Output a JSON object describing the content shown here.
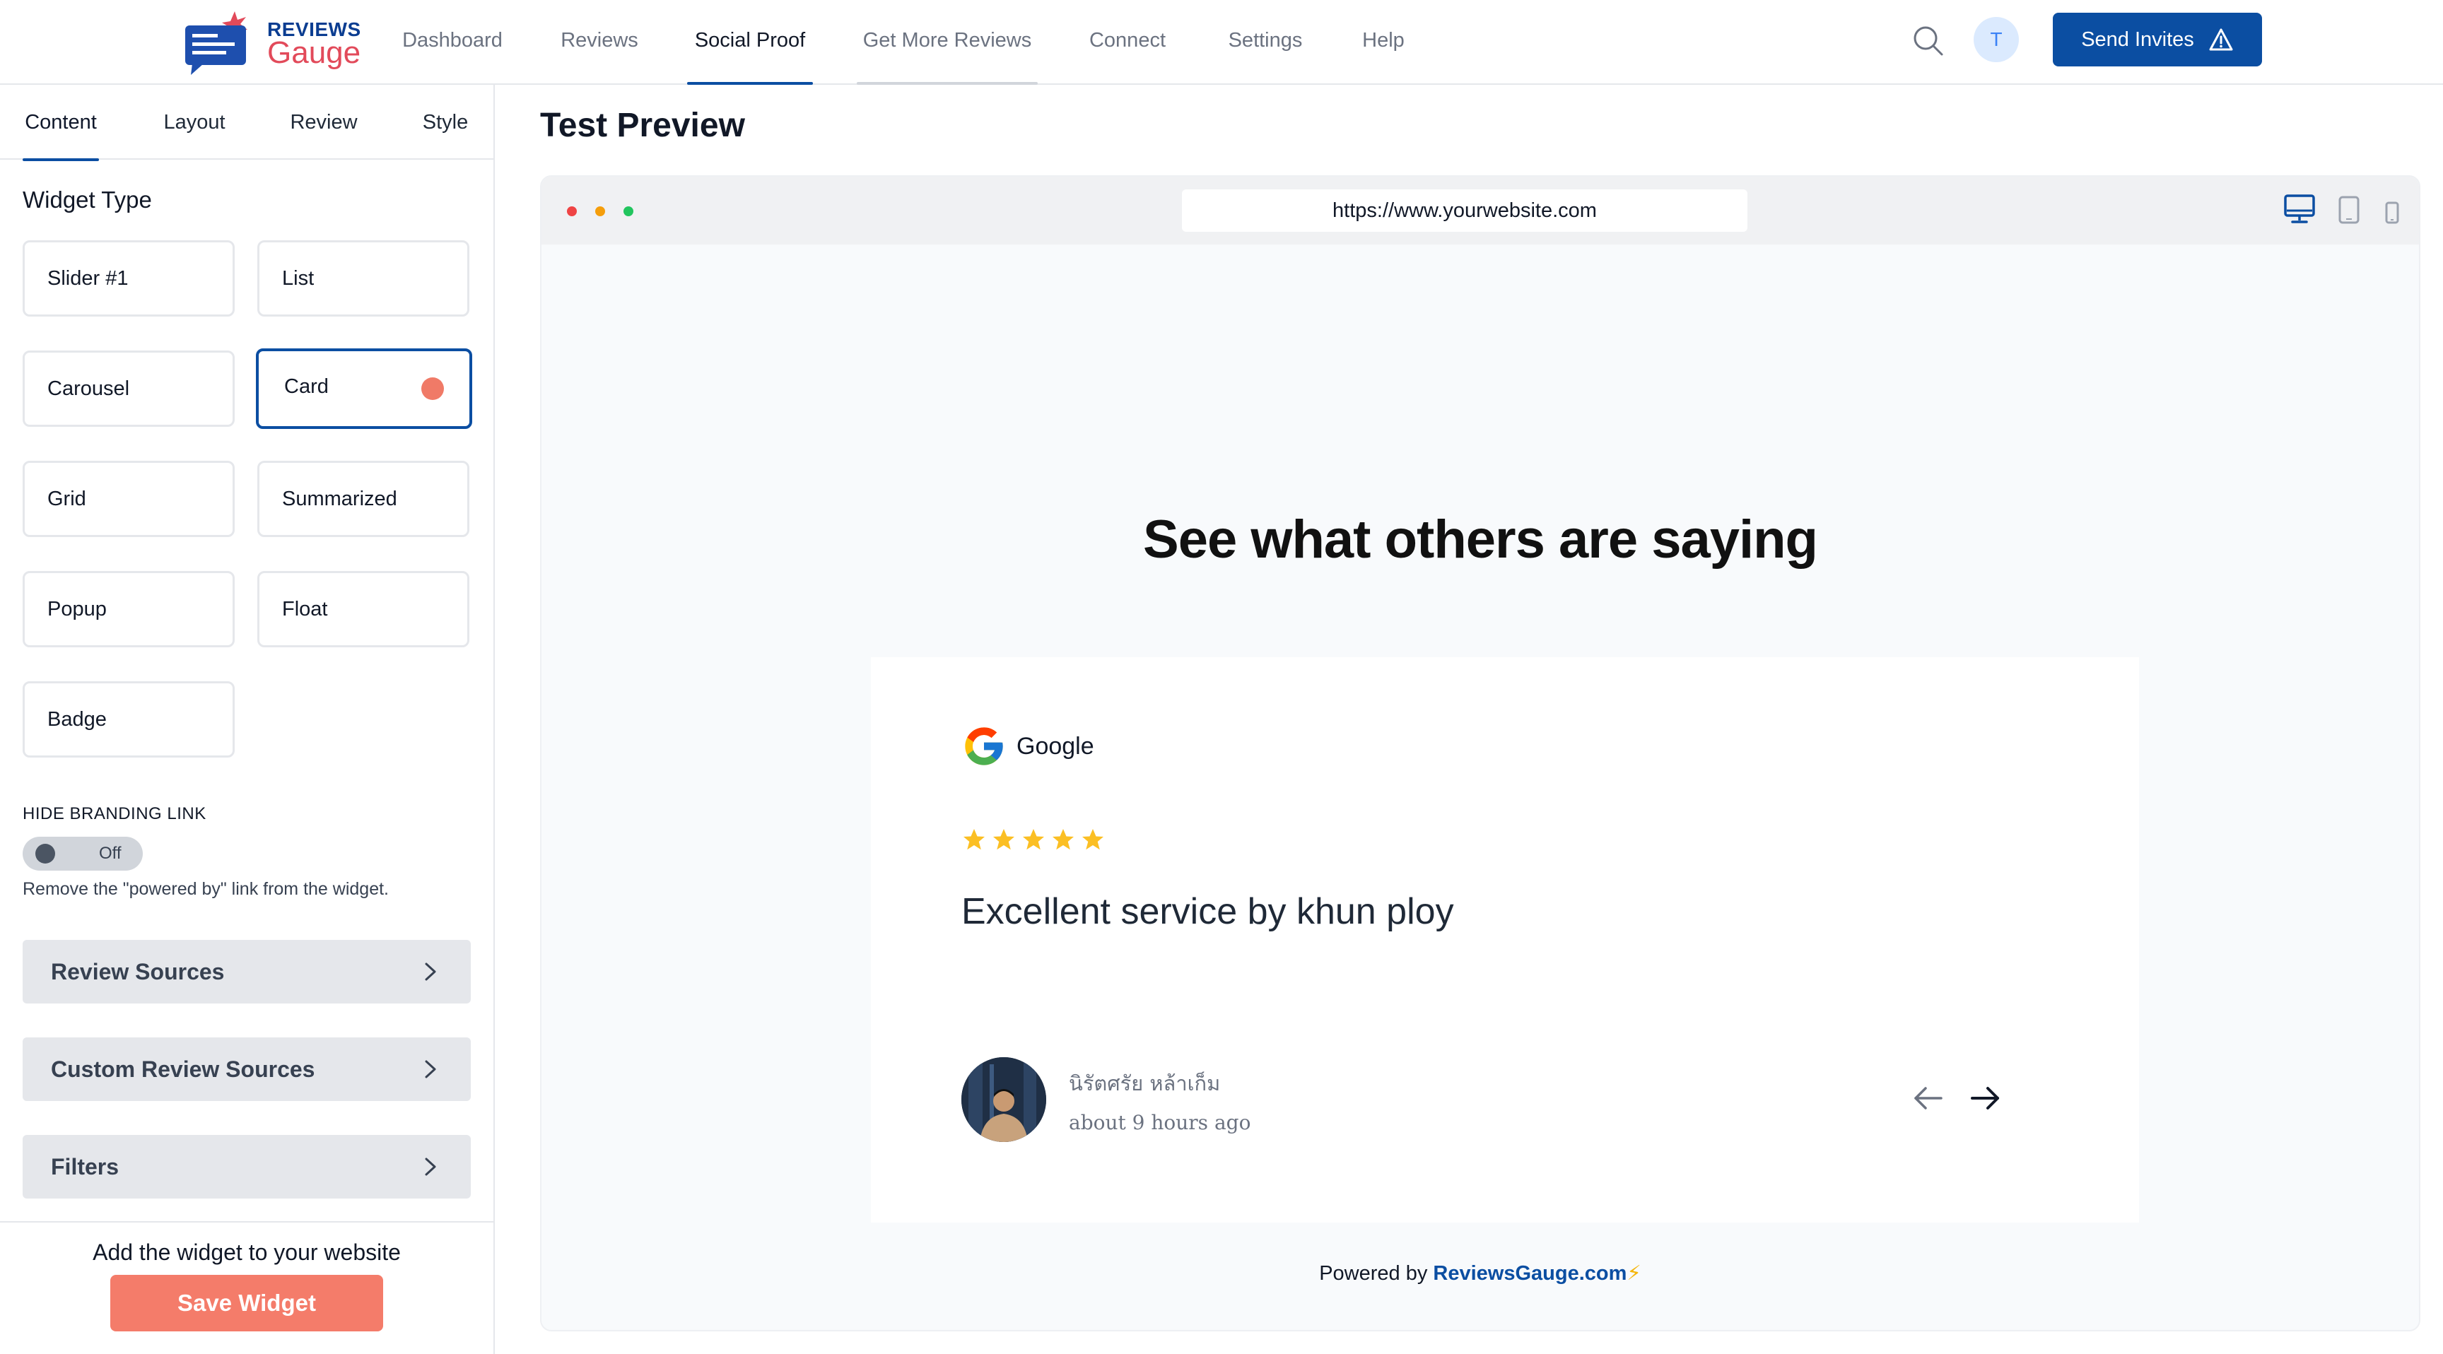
{
  "brand": {
    "word1": "REVIEWS",
    "word2": "Gauge",
    "colors": {
      "primary": "#0b4ea2",
      "accent": "#e24a5a",
      "save": "#f47c6a"
    }
  },
  "nav": {
    "items": [
      {
        "label": "Dashboard"
      },
      {
        "label": "Reviews"
      },
      {
        "label": "Social Proof",
        "active": true
      },
      {
        "label": "Get More Reviews"
      },
      {
        "label": "Connect"
      },
      {
        "label": "Settings"
      },
      {
        "label": "Help"
      }
    ],
    "avatar_initial": "T",
    "send_invites_label": "Send Invites"
  },
  "sidebar": {
    "tabs": [
      {
        "label": "Content",
        "active": true
      },
      {
        "label": "Layout"
      },
      {
        "label": "Review"
      },
      {
        "label": "Style"
      }
    ],
    "widget_type_title": "Widget Type",
    "widget_types": [
      {
        "label": "Slider #1"
      },
      {
        "label": "List"
      },
      {
        "label": "Carousel"
      },
      {
        "label": "Card",
        "selected": true
      },
      {
        "label": "Grid"
      },
      {
        "label": "Summarized"
      },
      {
        "label": "Popup"
      },
      {
        "label": "Float"
      },
      {
        "label": "Badge"
      }
    ],
    "branding": {
      "label": "HIDE BRANDING LINK",
      "toggle_state": "Off",
      "help": "Remove the \"powered by\" link from the widget."
    },
    "accordions": [
      {
        "label": "Review Sources"
      },
      {
        "label": "Custom Review Sources"
      },
      {
        "label": "Filters"
      }
    ],
    "footer": {
      "text": "Add the widget to your website",
      "save_label": "Save Widget"
    }
  },
  "main": {
    "title": "Test Preview",
    "browser": {
      "url": "https://www.yourwebsite.com",
      "dots": [
        "#ef4444",
        "#f59e0b",
        "#22c55e"
      ],
      "devices": [
        "desktop-icon",
        "tablet-icon",
        "mobile-icon"
      ]
    },
    "widget": {
      "headline": "See what others are saying",
      "review": {
        "provider": "Google",
        "rating": 5,
        "text": "Excellent service by khun ploy",
        "reviewer_name": "นิรัตศรัย หล้าเก็ม",
        "time": "about 9 hours ago"
      },
      "powered_prefix": "Powered by ",
      "powered_link": "ReviewsGauge.com",
      "powered_suffix": "⚡"
    }
  }
}
